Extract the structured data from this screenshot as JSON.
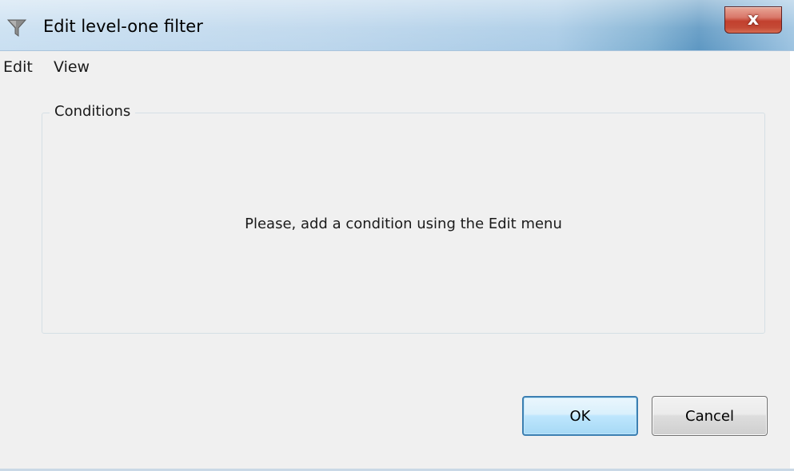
{
  "window": {
    "title": "Edit level-one filter",
    "app_icon": "funnel-filter-icon",
    "close_label": "x",
    "close_icon": "close-icon"
  },
  "menubar": {
    "items": [
      {
        "label": "Edit"
      },
      {
        "label": "View"
      }
    ]
  },
  "conditions": {
    "group_title": "Conditions",
    "empty_message": "Please, add a condition using the Edit menu"
  },
  "buttons": {
    "ok_label": "OK",
    "cancel_label": "Cancel"
  },
  "colors": {
    "window_background": "#f0f0f0",
    "close_button_red": "#c2402e",
    "default_button_border": "#3c7fb1"
  }
}
